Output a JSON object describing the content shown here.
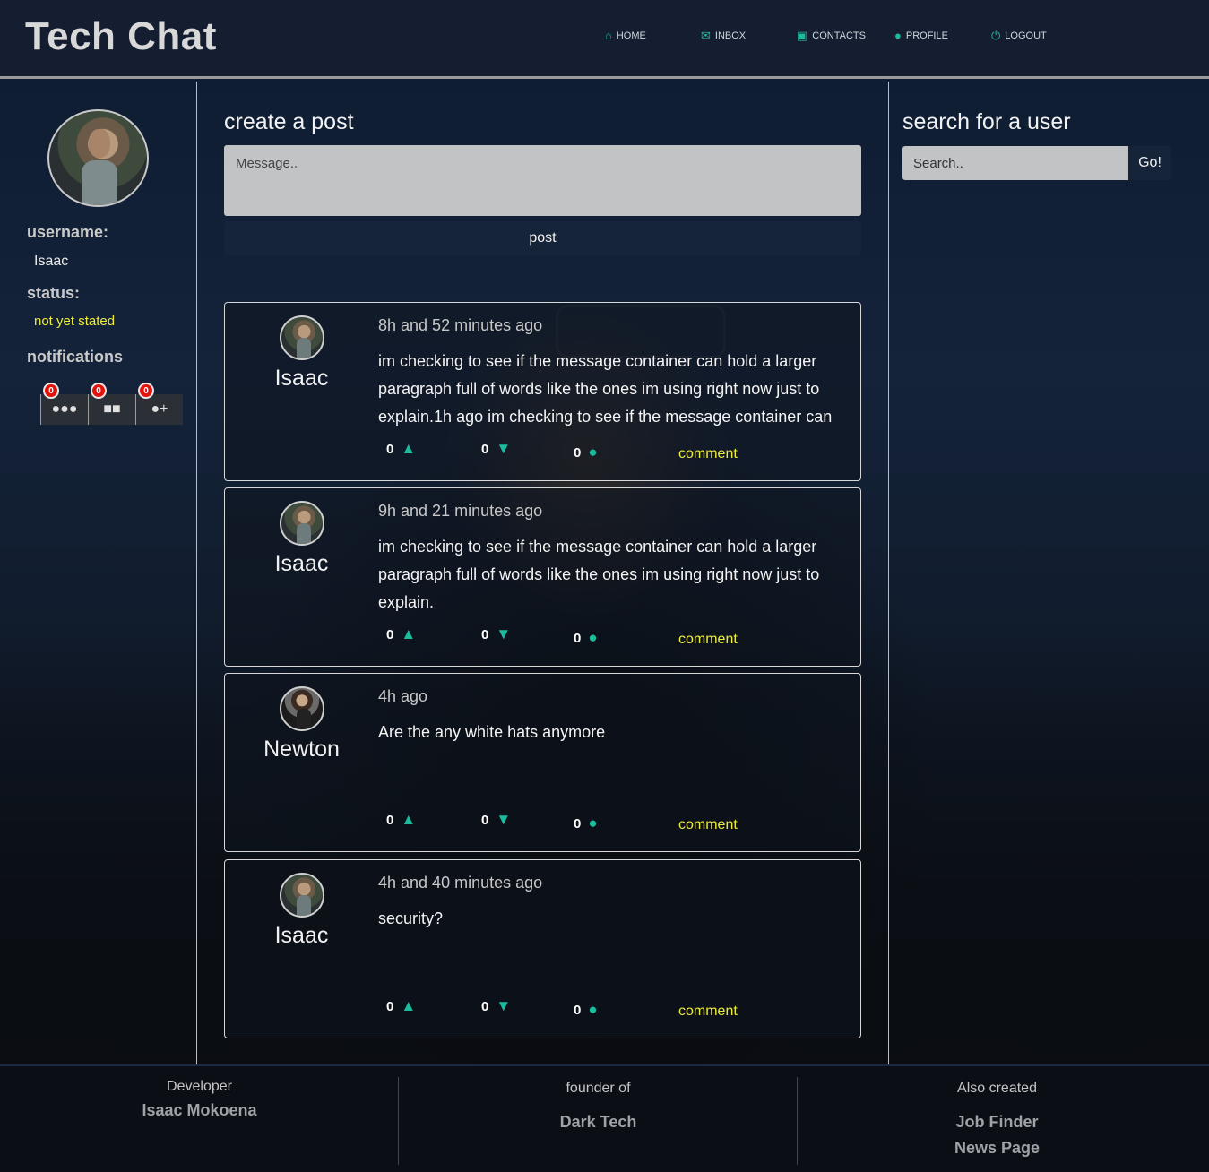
{
  "header": {
    "brand": "Tech Chat",
    "nav": [
      {
        "label": "HOME",
        "icon": "home-icon",
        "glyph": "⌂"
      },
      {
        "label": "INBOX",
        "icon": "envelope-icon",
        "glyph": "✉"
      },
      {
        "label": "CONTACTS",
        "icon": "address-book-icon",
        "glyph": "▣"
      },
      {
        "label": "PROFILE",
        "icon": "user-icon",
        "glyph": "●"
      },
      {
        "label": "LOGOUT",
        "icon": "power-icon",
        "glyph": "⏻"
      }
    ]
  },
  "sidebar": {
    "username_label": "username:",
    "username": "Isaac",
    "status_label": "status:",
    "status": "not yet stated",
    "notifications_label": "notifications",
    "notifications": [
      {
        "count": "0",
        "icon": "comment-icon",
        "glyph": "💬"
      },
      {
        "count": "0",
        "icon": "comments-icon",
        "glyph": "🗨"
      },
      {
        "count": "0",
        "icon": "user-plus-icon",
        "glyph": "👤+"
      }
    ]
  },
  "composer": {
    "title": "create a post",
    "placeholder": "Message..",
    "post_label": "post"
  },
  "posts": [
    {
      "author": "Isaac",
      "time": "8h and 52 minutes ago",
      "text": "im checking to see if the message container can hold a larger paragraph full of words like the ones im using right now just to explain.1h ago im checking to see if the message container can",
      "likes": "0",
      "dislikes": "0",
      "comments": "0",
      "comment_label": "comment"
    },
    {
      "author": "Isaac",
      "time": "9h and 21 minutes ago",
      "text": "im checking to see if the message container can hold a larger paragraph full of words like the ones im using right now just to explain.",
      "likes": "0",
      "dislikes": "0",
      "comments": "0",
      "comment_label": "comment"
    },
    {
      "author": "Newton",
      "time": "4h ago",
      "text": "Are the any white hats anymore",
      "likes": "0",
      "dislikes": "0",
      "comments": "0",
      "comment_label": "comment"
    },
    {
      "author": "Isaac",
      "time": "4h and 40 minutes ago",
      "text": "security?",
      "likes": "0",
      "dislikes": "0",
      "comments": "0",
      "comment_label": "comment"
    }
  ],
  "search": {
    "title": "search for a user",
    "placeholder": "Search..",
    "button_label": "Go!"
  },
  "footer": {
    "col1": {
      "heading": "Developer",
      "lines": [
        "Isaac Mokoena"
      ]
    },
    "col2": {
      "heading": "founder of",
      "lines": [
        "Dark Tech"
      ]
    },
    "col3": {
      "heading": "Also created",
      "lines": [
        "Job Finder",
        "News Page"
      ]
    }
  },
  "colors": {
    "accent": "#1abc9c",
    "highlight": "#eded3a",
    "badge": "#e3120b",
    "header_bg": "#141e30"
  }
}
